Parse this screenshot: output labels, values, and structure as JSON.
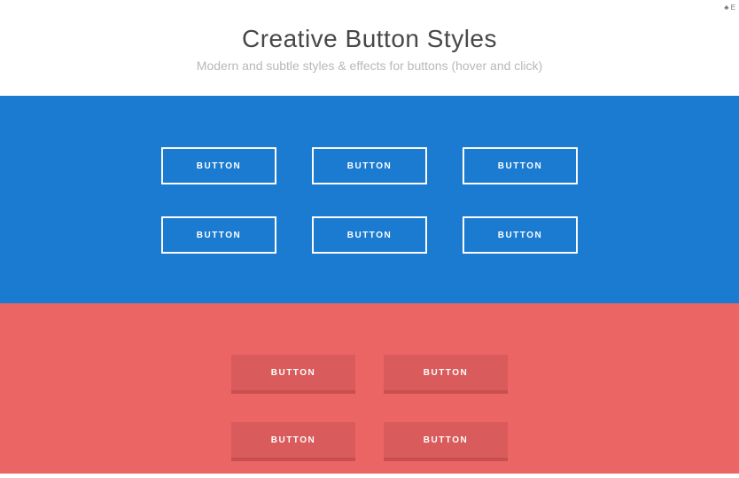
{
  "topbar": {
    "badge": "♣ E"
  },
  "header": {
    "title": "Creative Button Styles",
    "subtitle": "Modern and subtle styles & effects for buttons (hover and click)"
  },
  "sections": {
    "blue": {
      "row1": [
        "BUTTON",
        "BUTTON",
        "BUTTON"
      ],
      "row2": [
        "BUTTON",
        "BUTTON",
        "BUTTON"
      ]
    },
    "red": {
      "row1": [
        "BUTTON",
        "BUTTON"
      ],
      "row2": [
        "BUTTON",
        "BUTTON"
      ]
    }
  },
  "colors": {
    "blue": "#1b7bd0",
    "red": "#eb6565",
    "raised": "#d95b5b",
    "raisedShadow": "#c94f4f"
  }
}
